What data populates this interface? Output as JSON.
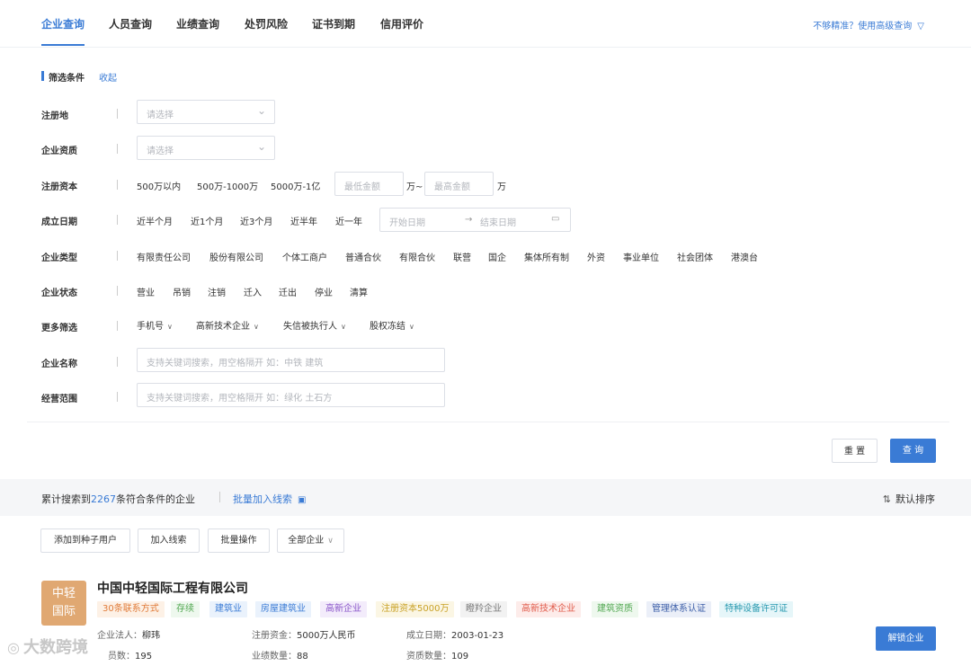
{
  "tabs": [
    {
      "label": "企业查询"
    },
    {
      "label": "人员查询"
    },
    {
      "label": "业绩查询"
    },
    {
      "label": "处罚风险"
    },
    {
      "label": "证书到期"
    },
    {
      "label": "信用评价"
    }
  ],
  "advanced_link": "不够精准？使用高级查询",
  "filter": {
    "title": "筛选条件",
    "collapse": "收起",
    "reg_place": {
      "label": "注册地",
      "placeholder": "请选择"
    },
    "qualification": {
      "label": "企业资质",
      "placeholder": "请选择"
    },
    "reg_capital": {
      "label": "注册资本",
      "options": [
        "500万以内",
        "500万-1000万",
        "5000万-1亿"
      ],
      "min_placeholder": "最低金额",
      "max_placeholder": "最高金额",
      "unit_mid": "万~",
      "unit_end": "万"
    },
    "found_date": {
      "label": "成立日期",
      "options": [
        "近半个月",
        "近1个月",
        "近3个月",
        "近半年",
        "近一年"
      ],
      "start_placeholder": "开始日期",
      "arrow": "→",
      "end_placeholder": "结束日期"
    },
    "company_type": {
      "label": "企业类型",
      "options": [
        "有限责任公司",
        "股份有限公司",
        "个体工商户",
        "普通合伙",
        "有限合伙",
        "联营",
        "国企",
        "集体所有制",
        "外资",
        "事业单位",
        "社会团体",
        "港澳台"
      ]
    },
    "company_status": {
      "label": "企业状态",
      "options": [
        "营业",
        "吊销",
        "注销",
        "迁入",
        "迁出",
        "停业",
        "清算"
      ]
    },
    "more": {
      "label": "更多筛选",
      "options": [
        "手机号",
        "高新技术企业",
        "失信被执行人",
        "股权冻结"
      ]
    },
    "company_name": {
      "label": "企业名称",
      "placeholder": "支持关键词搜索，用空格隔开 如：中铁 建筑"
    },
    "business_scope": {
      "label": "经营范围",
      "placeholder": "支持关键词搜索，用空格隔开 如：绿化 土石方"
    },
    "reset": "重 置",
    "query": "查 询"
  },
  "results": {
    "prefix": "累计搜索到",
    "count": "2267",
    "suffix": "条符合条件的企业",
    "batch_link": "批量加入线索",
    "sort": "默认排序"
  },
  "actions": [
    "添加到种子用户",
    "加入线索",
    "批量操作",
    "全部企业"
  ],
  "company": {
    "logo_line1": "中轻",
    "logo_line2": "国际",
    "name": "中国中轻国际工程有限公司",
    "tags": [
      {
        "text": "30条联系方式",
        "color": "#e07b39",
        "bg": "#fdf1e6"
      },
      {
        "text": "存续",
        "color": "#52a852",
        "bg": "#eef8ee"
      },
      {
        "text": "建筑业",
        "color": "#3a7bd5",
        "bg": "#eaf2fc"
      },
      {
        "text": "房屋建筑业",
        "color": "#3a7bd5",
        "bg": "#eaf2fc"
      },
      {
        "text": "高新企业",
        "color": "#8a56c9",
        "bg": "#f3ecfb"
      },
      {
        "text": "注册资本5000万",
        "color": "#c9a227",
        "bg": "#fbf6e4"
      },
      {
        "text": "瞪羚企业",
        "color": "#777777",
        "bg": "#f2f2f2"
      },
      {
        "text": "高新技术企业",
        "color": "#e05a4a",
        "bg": "#fdecea"
      },
      {
        "text": "建筑资质",
        "color": "#52a852",
        "bg": "#eef8ee"
      },
      {
        "text": "管理体系认证",
        "color": "#3d5fa8",
        "bg": "#ebeff8"
      },
      {
        "text": "特种设备许可证",
        "color": "#2a9ab0",
        "bg": "#e6f6f9"
      }
    ],
    "legal_rep": {
      "k": "企业法人：",
      "v": "柳玮"
    },
    "reg_capital": {
      "k": "注册资金：",
      "v": "5000万人民币"
    },
    "found_date": {
      "k": "成立日期：",
      "v": "2003-01-23"
    },
    "staff": {
      "k": "员数：",
      "v": "195"
    },
    "projects": {
      "k": "业绩数量：",
      "v": "88"
    },
    "qualifications": {
      "k": "资质数量：",
      "v": "109"
    },
    "unlock": "解锁企业"
  },
  "watermark": "大数跨境"
}
